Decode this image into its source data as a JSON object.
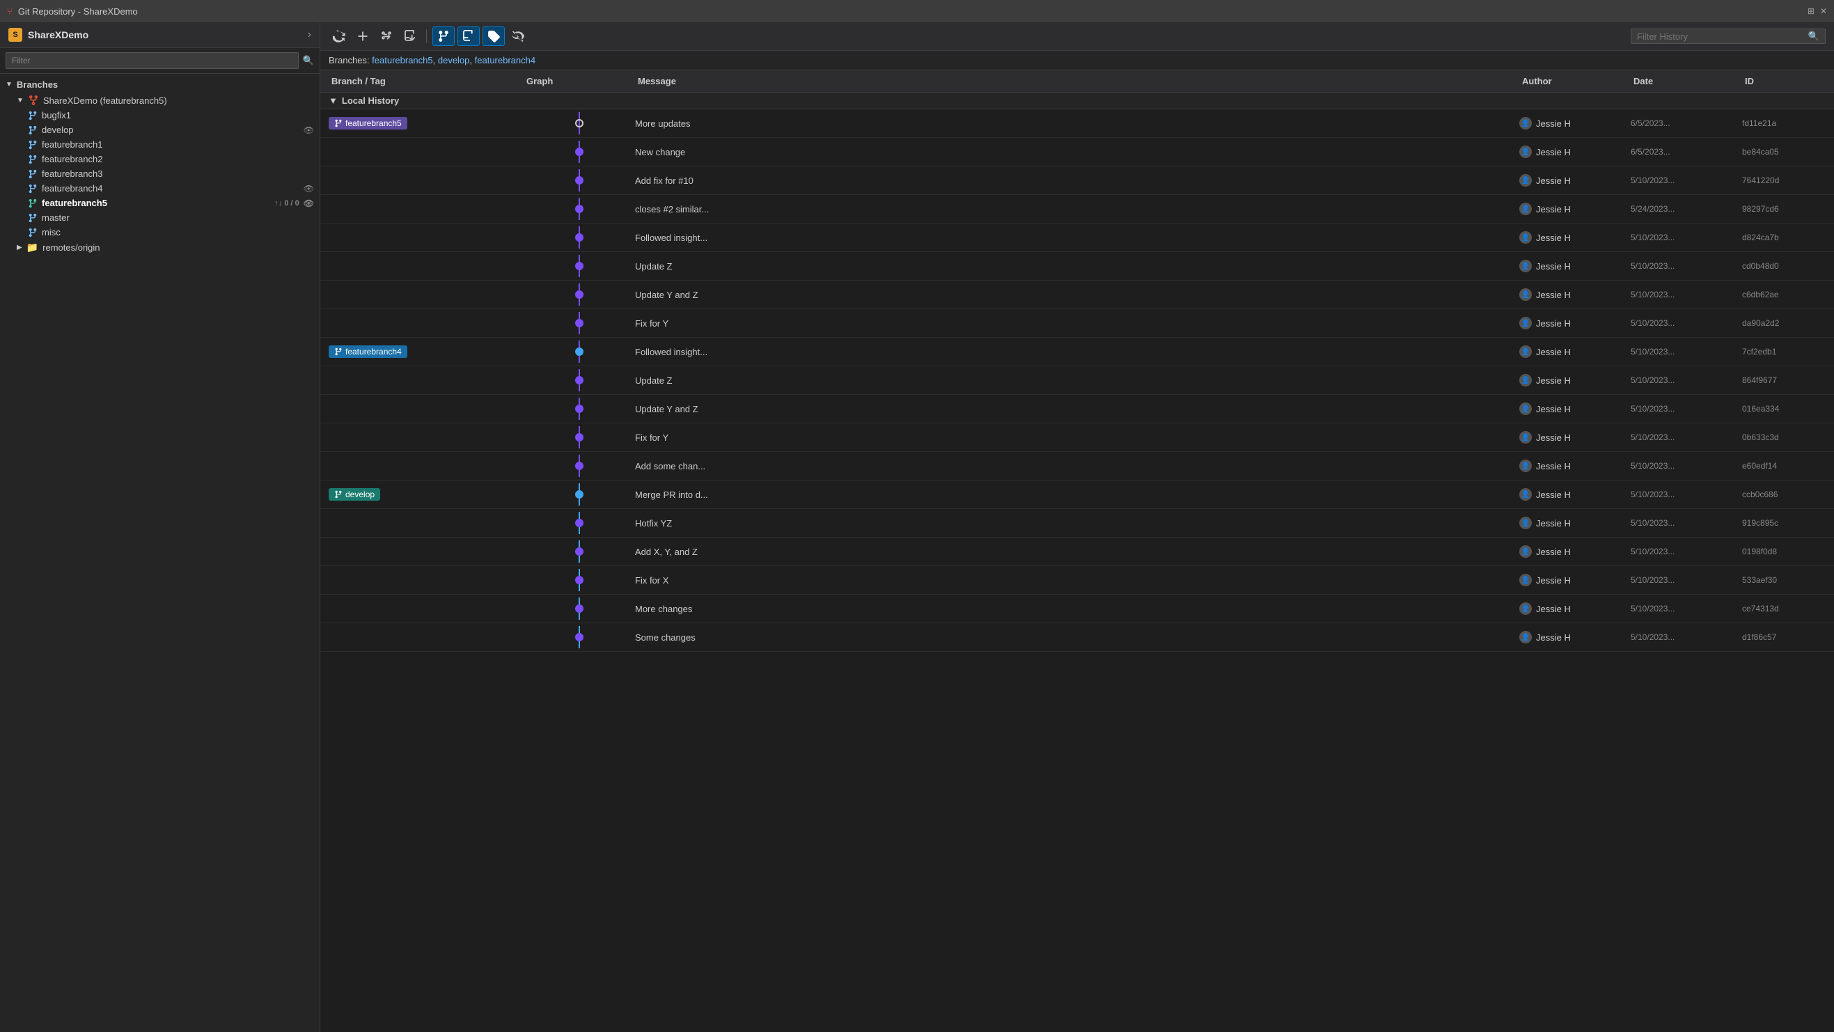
{
  "titleBar": {
    "title": "Git Repository - ShareXDemo",
    "pinIcon": "📌",
    "closeIcon": "✕"
  },
  "sidebar": {
    "title": "ShareXDemo",
    "filterPlaceholder": "Filter",
    "sections": [
      {
        "name": "Branches",
        "expanded": true,
        "root": {
          "label": "ShareXDemo (featurebranch5)",
          "expanded": true
        },
        "branches": [
          {
            "name": "bugfix1",
            "active": false,
            "hasEye": false,
            "hasSyncBadge": false
          },
          {
            "name": "develop",
            "active": false,
            "hasEye": true,
            "hasSyncBadge": false
          },
          {
            "name": "featurebranch1",
            "active": false,
            "hasEye": false,
            "hasSyncBadge": false
          },
          {
            "name": "featurebranch2",
            "active": false,
            "hasEye": false,
            "hasSyncBadge": false
          },
          {
            "name": "featurebranch3",
            "active": false,
            "hasEye": false,
            "hasSyncBadge": false
          },
          {
            "name": "featurebranch4",
            "active": false,
            "hasEye": true,
            "hasSyncBadge": false
          },
          {
            "name": "featurebranch5",
            "active": true,
            "hasEye": true,
            "syncBadge": "↑↓ 0 / 0"
          },
          {
            "name": "master",
            "active": false,
            "hasEye": false,
            "hasSyncBadge": false
          },
          {
            "name": "misc",
            "active": false,
            "hasEye": false,
            "hasSyncBadge": false
          }
        ],
        "remotes": [
          {
            "name": "remotes/origin",
            "expanded": false
          }
        ]
      }
    ]
  },
  "toolbar": {
    "filterHistoryPlaceholder": "Filter History",
    "buttons": [
      {
        "id": "refresh",
        "icon": "↺",
        "label": "Refresh",
        "active": false
      },
      {
        "id": "fetch",
        "icon": "⟳",
        "label": "Fetch",
        "active": false
      },
      {
        "id": "pull",
        "icon": "⬇",
        "label": "Pull",
        "active": false
      },
      {
        "id": "push",
        "icon": "⬆",
        "label": "Push",
        "active": false
      },
      {
        "id": "branch",
        "icon": "⑂",
        "label": "Branch",
        "active": true
      },
      {
        "id": "merge",
        "icon": "⑃",
        "label": "Merge",
        "active": true
      },
      {
        "id": "tag",
        "icon": "◇",
        "label": "Tag",
        "active": true
      },
      {
        "id": "stash",
        "icon": "👁",
        "label": "Stash",
        "active": false
      }
    ]
  },
  "branchesHeaderText": "Branches:",
  "branchLinks": [
    "featurebranch5",
    "develop",
    "featurebranch4"
  ],
  "tableHeaders": [
    "Branch / Tag",
    "Graph",
    "Message",
    "Author",
    "Date",
    "ID"
  ],
  "localHistoryLabel": "Local History",
  "commits": [
    {
      "branchTag": "featurebranch5",
      "branchColor": "purple",
      "graphDot": "empty",
      "graphType": "line",
      "message": "More updates",
      "author": "Jessie H",
      "date": "6/5/2023...",
      "id": "fd11e21a"
    },
    {
      "branchTag": "",
      "graphType": "line",
      "message": "New change",
      "author": "Jessie H",
      "date": "6/5/2023...",
      "id": "be84ca05"
    },
    {
      "branchTag": "",
      "graphType": "line",
      "message": "Add fix for #10",
      "author": "Jessie H",
      "date": "5/10/2023...",
      "id": "7641220d"
    },
    {
      "branchTag": "",
      "graphType": "line",
      "message": "closes #2 similar...",
      "author": "Jessie H",
      "date": "5/24/2023...",
      "id": "98297cd6"
    },
    {
      "branchTag": "",
      "graphType": "line",
      "message": "Followed insight...",
      "author": "Jessie H",
      "date": "5/10/2023...",
      "id": "d824ca7b"
    },
    {
      "branchTag": "",
      "graphType": "line",
      "message": "Update Z",
      "author": "Jessie H",
      "date": "5/10/2023...",
      "id": "cd0b48d0"
    },
    {
      "branchTag": "",
      "graphType": "line",
      "message": "Update Y and Z",
      "author": "Jessie H",
      "date": "5/10/2023...",
      "id": "c6db62ae"
    },
    {
      "branchTag": "",
      "graphType": "line",
      "message": "Fix for Y",
      "author": "Jessie H",
      "date": "5/10/2023...",
      "id": "da90a2d2"
    },
    {
      "branchTag": "featurebranch4",
      "branchColor": "blue",
      "graphDot": "filled",
      "graphType": "line",
      "message": "Followed insight...",
      "author": "Jessie H",
      "date": "5/10/2023...",
      "id": "7cf2edb1"
    },
    {
      "branchTag": "",
      "graphType": "line",
      "message": "Update Z",
      "author": "Jessie H",
      "date": "5/10/2023...",
      "id": "864f9677"
    },
    {
      "branchTag": "",
      "graphType": "line",
      "message": "Update Y and Z",
      "author": "Jessie H",
      "date": "5/10/2023...",
      "id": "016ea334"
    },
    {
      "branchTag": "",
      "graphType": "line",
      "message": "Fix for Y",
      "author": "Jessie H",
      "date": "5/10/2023...",
      "id": "0b633c3d"
    },
    {
      "branchTag": "",
      "graphType": "line",
      "message": "Add some chan...",
      "author": "Jessie H",
      "date": "5/10/2023...",
      "id": "e60edf14"
    },
    {
      "branchTag": "develop",
      "branchColor": "teal",
      "graphDot": "filled",
      "graphType": "line",
      "message": "Merge PR into d...",
      "author": "Jessie H",
      "date": "5/10/2023...",
      "id": "ccb0c686"
    },
    {
      "branchTag": "",
      "graphType": "line",
      "message": "Hotfix YZ",
      "author": "Jessie H",
      "date": "5/10/2023...",
      "id": "919c895c"
    },
    {
      "branchTag": "",
      "graphType": "line",
      "message": "Add X, Y, and Z",
      "author": "Jessie H",
      "date": "5/10/2023...",
      "id": "0198f0d8"
    },
    {
      "branchTag": "",
      "graphType": "line",
      "message": "Fix for X",
      "author": "Jessie H",
      "date": "5/10/2023...",
      "id": "533aef30"
    },
    {
      "branchTag": "",
      "graphType": "line",
      "message": "More changes",
      "author": "Jessie H",
      "date": "5/10/2023...",
      "id": "ce74313d"
    },
    {
      "branchTag": "",
      "graphType": "line",
      "message": "Some changes",
      "author": "Jessie H",
      "date": "5/10/2023...",
      "id": "d1f86c57"
    }
  ]
}
